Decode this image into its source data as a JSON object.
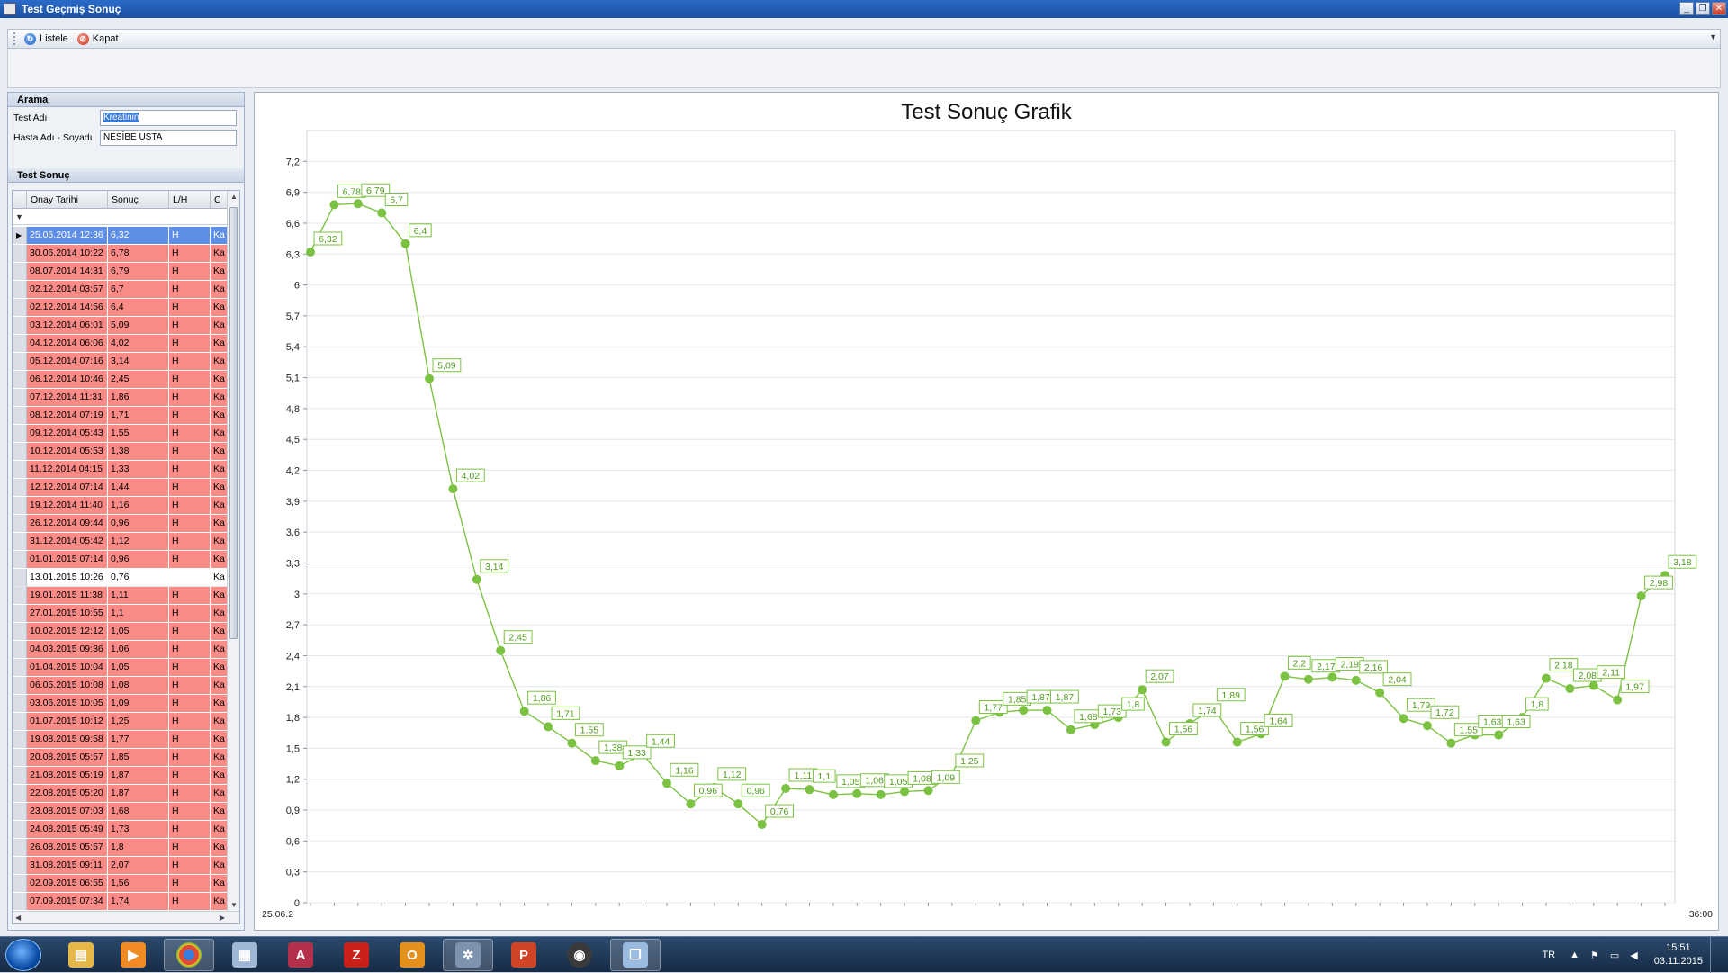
{
  "window": {
    "title": "Test Geçmiş Sonuç"
  },
  "toolbar": {
    "list_label": "Listele",
    "close_label": "Kapat"
  },
  "search": {
    "header": "Arama",
    "test_label": "Test Adı",
    "test_value": "Kreatinin",
    "patient_label": "Hasta Adı - Soyadı",
    "patient_value": "NESİBE USTA"
  },
  "results": {
    "header": "Test Sonuç",
    "columns": [
      "Onay Tarihi",
      "Sonuç",
      "L/H",
      "C"
    ],
    "rows": [
      {
        "date": "25.06.2014 12:36",
        "value": "6,32",
        "lh": "H",
        "c": "Ka",
        "selected": true
      },
      {
        "date": "30.06.2014 10:22",
        "value": "6,78",
        "lh": "H",
        "c": "Ka"
      },
      {
        "date": "08.07.2014 14:31",
        "value": "6,79",
        "lh": "H",
        "c": "Ka"
      },
      {
        "date": "02.12.2014 03:57",
        "value": "6,7",
        "lh": "H",
        "c": "Ka"
      },
      {
        "date": "02.12.2014 14:56",
        "value": "6,4",
        "lh": "H",
        "c": "Ka"
      },
      {
        "date": "03.12.2014 06:01",
        "value": "5,09",
        "lh": "H",
        "c": "Ka"
      },
      {
        "date": "04.12.2014 06:06",
        "value": "4,02",
        "lh": "H",
        "c": "Ka"
      },
      {
        "date": "05.12.2014 07:16",
        "value": "3,14",
        "lh": "H",
        "c": "Ka"
      },
      {
        "date": "06.12.2014 10:46",
        "value": "2,45",
        "lh": "H",
        "c": "Ka"
      },
      {
        "date": "07.12.2014 11:31",
        "value": "1,86",
        "lh": "H",
        "c": "Ka"
      },
      {
        "date": "08.12.2014 07:19",
        "value": "1,71",
        "lh": "H",
        "c": "Ka"
      },
      {
        "date": "09.12.2014 05:43",
        "value": "1,55",
        "lh": "H",
        "c": "Ka"
      },
      {
        "date": "10.12.2014 05:53",
        "value": "1,38",
        "lh": "H",
        "c": "Ka"
      },
      {
        "date": "11.12.2014 04:15",
        "value": "1,33",
        "lh": "H",
        "c": "Ka"
      },
      {
        "date": "12.12.2014 07:14",
        "value": "1,44",
        "lh": "H",
        "c": "Ka"
      },
      {
        "date": "19.12.2014 11:40",
        "value": "1,16",
        "lh": "H",
        "c": "Ka"
      },
      {
        "date": "26.12.2014 09:44",
        "value": "0,96",
        "lh": "H",
        "c": "Ka"
      },
      {
        "date": "31.12.2014 05:42",
        "value": "1,12",
        "lh": "H",
        "c": "Ka"
      },
      {
        "date": "01.01.2015 07:14",
        "value": "0,96",
        "lh": "H",
        "c": "Ka"
      },
      {
        "date": "13.01.2015 10:26",
        "value": "0,76",
        "lh": "",
        "c": "Ka",
        "normal": true
      },
      {
        "date": "19.01.2015 11:38",
        "value": "1,11",
        "lh": "H",
        "c": "Ka"
      },
      {
        "date": "27.01.2015 10:55",
        "value": "1,1",
        "lh": "H",
        "c": "Ka"
      },
      {
        "date": "10.02.2015 12:12",
        "value": "1,05",
        "lh": "H",
        "c": "Ka"
      },
      {
        "date": "04.03.2015 09:36",
        "value": "1,06",
        "lh": "H",
        "c": "Ka"
      },
      {
        "date": "01.04.2015 10:04",
        "value": "1,05",
        "lh": "H",
        "c": "Ka"
      },
      {
        "date": "06.05.2015 10:08",
        "value": "1,08",
        "lh": "H",
        "c": "Ka"
      },
      {
        "date": "03.06.2015 10:05",
        "value": "1,09",
        "lh": "H",
        "c": "Ka"
      },
      {
        "date": "01.07.2015 10:12",
        "value": "1,25",
        "lh": "H",
        "c": "Ka"
      },
      {
        "date": "19.08.2015 09:58",
        "value": "1,77",
        "lh": "H",
        "c": "Ka"
      },
      {
        "date": "20.08.2015 05:57",
        "value": "1,85",
        "lh": "H",
        "c": "Ka"
      },
      {
        "date": "21.08.2015 05:19",
        "value": "1,87",
        "lh": "H",
        "c": "Ka"
      },
      {
        "date": "22.08.2015 05:20",
        "value": "1,87",
        "lh": "H",
        "c": "Ka"
      },
      {
        "date": "23.08.2015 07:03",
        "value": "1,68",
        "lh": "H",
        "c": "Ka"
      },
      {
        "date": "24.08.2015 05:49",
        "value": "1,73",
        "lh": "H",
        "c": "Ka"
      },
      {
        "date": "26.08.2015 05:57",
        "value": "1,8",
        "lh": "H",
        "c": "Ka"
      },
      {
        "date": "31.08.2015 09:11",
        "value": "2,07",
        "lh": "H",
        "c": "Ka"
      },
      {
        "date": "02.09.2015 06:55",
        "value": "1,56",
        "lh": "H",
        "c": "Ka"
      },
      {
        "date": "07.09.2015 07:34",
        "value": "1,74",
        "lh": "H",
        "c": "Ka"
      }
    ]
  },
  "chart_data": {
    "type": "line",
    "title": "Test Sonuç Grafik",
    "ylim": [
      0,
      7.5
    ],
    "yticks": [
      "0",
      "0,3",
      "0,6",
      "0,9",
      "1,2",
      "1,5",
      "1,8",
      "2,1",
      "2,4",
      "2,7",
      "3",
      "3,3",
      "3,6",
      "3,9",
      "4,2",
      "4,5",
      "4,8",
      "5,1",
      "5,4",
      "5,7",
      "6",
      "6,3",
      "6,6",
      "6,9",
      "7,2"
    ],
    "first_x_label": "25.06.2",
    "last_x_label": "36:00",
    "series_color": "#7cc242",
    "values": [
      6.32,
      6.78,
      6.79,
      6.7,
      6.4,
      5.09,
      4.02,
      3.14,
      2.45,
      1.86,
      1.71,
      1.55,
      1.38,
      1.33,
      1.44,
      1.16,
      0.96,
      1.12,
      0.96,
      0.76,
      1.11,
      1.1,
      1.05,
      1.06,
      1.05,
      1.08,
      1.09,
      1.25,
      1.77,
      1.85,
      1.87,
      1.87,
      1.68,
      1.73,
      1.8,
      2.07,
      1.56,
      1.74,
      1.89,
      1.56,
      1.64,
      2.2,
      2.17,
      2.19,
      2.16,
      2.04,
      1.79,
      1.72,
      1.55,
      1.63,
      1.63,
      1.8,
      2.18,
      2.08,
      2.11,
      1.97,
      2.98,
      3.18
    ],
    "labels": [
      "6,32",
      "6,78",
      "6,79",
      "6,7",
      "6,4",
      "5,09",
      "4,02",
      "3,14",
      "2,45",
      "1,86",
      "1,71",
      "1,55",
      "1,38",
      "1,33",
      "1,44",
      "1,16",
      "0,96",
      "1,12",
      "0,96",
      "0,76",
      "1,11",
      "1,1",
      "1,05",
      "1,06",
      "1,05",
      "1,08",
      "1,09",
      "1,25",
      "1,77",
      "1,85",
      "1,87",
      "1,87",
      "1,68",
      "1,73",
      "1,8",
      "2,07",
      "1,56",
      "1,74",
      "1,89",
      "1,56",
      "1,64",
      "2,2",
      "2,17",
      "2,19",
      "2,16",
      "2,04",
      "1,79",
      "1,72",
      "1,55",
      "1,63",
      "1,63",
      "1,8",
      "2,18",
      "2,08",
      "2,11",
      "1,97",
      "2,98",
      "3,18"
    ]
  },
  "taskbar": {
    "lang": "TR",
    "time": "15:51",
    "date": "03.11.2015"
  }
}
